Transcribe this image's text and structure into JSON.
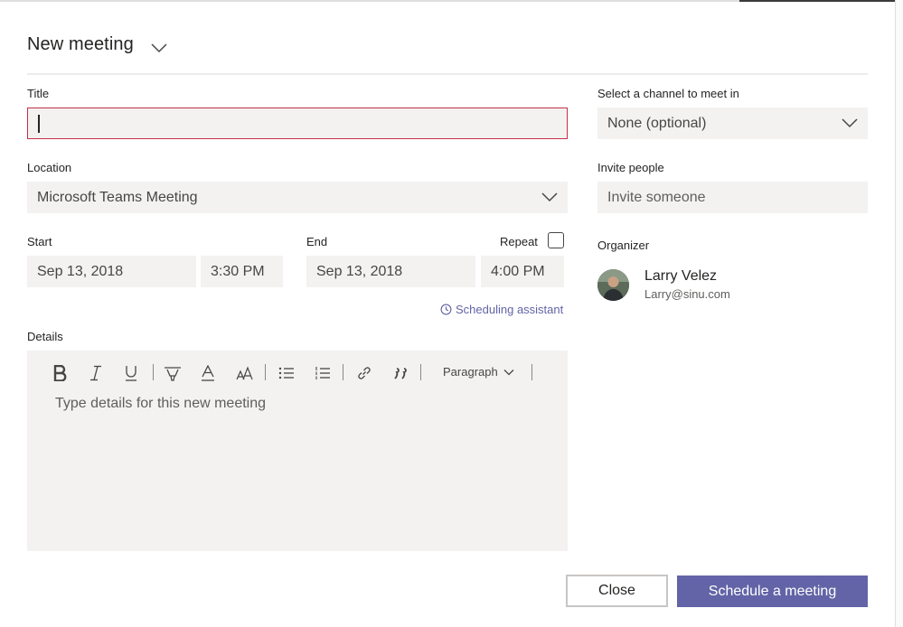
{
  "header": {
    "title": "New meeting"
  },
  "form": {
    "title_label": "Title",
    "title_value": "",
    "location_label": "Location",
    "location_value": "Microsoft Teams Meeting",
    "start_label": "Start",
    "start_date": "Sep 13, 2018",
    "start_time": "3:30 PM",
    "end_label": "End",
    "end_date": "Sep 13, 2018",
    "end_time": "4:00 PM",
    "repeat_label": "Repeat",
    "repeat_checked": false,
    "scheduling_assistant": "Scheduling assistant",
    "details_label": "Details",
    "details_placeholder": "Type details for this new meeting"
  },
  "toolbar": {
    "paragraph_label": "Paragraph",
    "icons": [
      "bold-icon",
      "italic-icon",
      "underline-icon",
      "highlight-icon",
      "font-color-icon",
      "font-size-icon",
      "bulleted-list-icon",
      "numbered-list-icon",
      "link-icon",
      "quote-icon"
    ]
  },
  "sidebar": {
    "channel_label": "Select a channel to meet in",
    "channel_value": "None (optional)",
    "invite_label": "Invite people",
    "invite_placeholder": "Invite someone",
    "organizer_label": "Organizer",
    "organizer_name": "Larry Velez",
    "organizer_email": "Larry@sinu.com"
  },
  "footer": {
    "close_label": "Close",
    "schedule_label": "Schedule a meeting"
  },
  "colors": {
    "accent": "#6264a7",
    "error_border": "#c4314b",
    "field_bg": "#f3f2f1"
  }
}
